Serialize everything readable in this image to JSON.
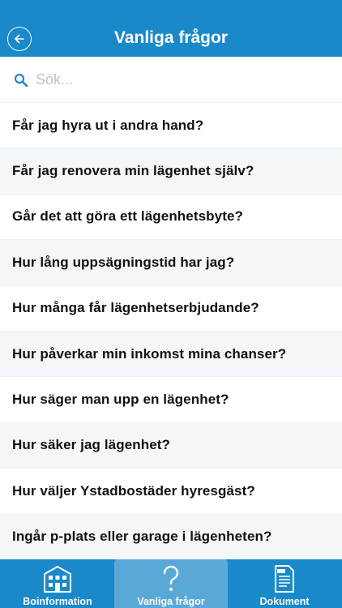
{
  "header": {
    "title": "Vanliga frågor",
    "back_icon": "back-arrow-circle-icon"
  },
  "search": {
    "placeholder": "Sök...",
    "value": "",
    "icon": "search-icon"
  },
  "faq": {
    "items": [
      "Får jag hyra ut i andra hand?",
      "Får jag renovera min lägenhet själv?",
      "Går det att göra ett lägenhetsbyte?",
      "Hur lång uppsägningstid har jag?",
      "Hur många får lägenhetserbjudande?",
      "Hur påverkar min inkomst mina chanser?",
      "Hur säger man upp en lägenhet?",
      "Hur säker jag lägenhet?",
      "Hur väljer Ystadbostäder hyresgäst?",
      "Ingår p-plats eller garage i lägenheten?"
    ]
  },
  "tabbar": {
    "tabs": [
      {
        "label": "Boinformation",
        "icon": "building-icon",
        "active": false
      },
      {
        "label": "Vanliga frågor",
        "icon": "question-mark-icon",
        "active": true
      },
      {
        "label": "Dokument",
        "icon": "pdf-document-icon",
        "active": false
      }
    ]
  },
  "colors": {
    "primary": "#1a89c9",
    "active_tab": "#5aa8d8",
    "row_alt": "#f3f7fa"
  }
}
